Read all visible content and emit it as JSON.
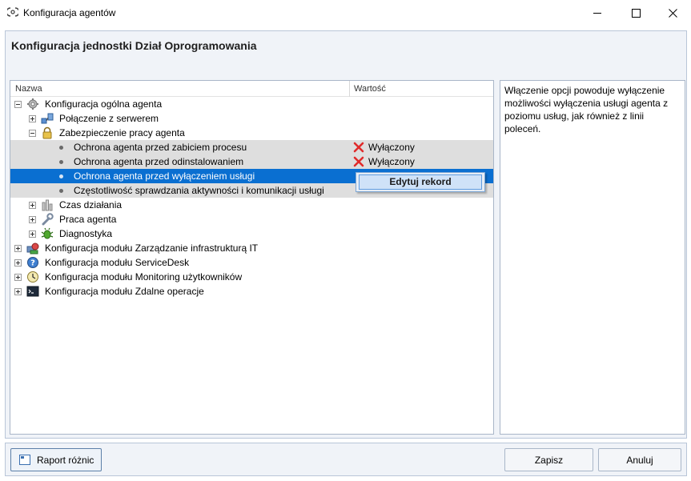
{
  "window": {
    "title": "Konfiguracja agentów",
    "minimize_icon": "minimize-icon",
    "maximize_icon": "maximize-icon",
    "close_icon": "close-icon"
  },
  "panel": {
    "title": "Konfiguracja jednostki Dział Oprogramowania"
  },
  "tree": {
    "columns": {
      "name": "Nazwa",
      "value": "Wartość"
    },
    "rows": [
      {
        "label": "Konfiguracja ogólna agenta",
        "icon": "gear-icon",
        "expanded": true
      },
      {
        "label": "Połączenie z serwerem",
        "icon": "network-icon",
        "expanded": false
      },
      {
        "label": "Zabezpieczenie pracy agenta",
        "icon": "lock-icon",
        "expanded": true
      },
      {
        "label": "Ochrona agenta przed zabiciem procesu",
        "value": "Wyłączony",
        "value_icon": "red-x-icon"
      },
      {
        "label": "Ochrona agenta przed odinstalowaniem",
        "value": "Wyłączony",
        "value_icon": "red-x-icon"
      },
      {
        "label": "Ochrona agenta przed wyłączeniem usługi",
        "selected": true
      },
      {
        "label": "Częstotliwość sprawdzania aktywności i komunikacji usługi"
      },
      {
        "label": "Czas działania",
        "icon": "hourglass-icon",
        "expanded": false
      },
      {
        "label": "Praca agenta",
        "icon": "wrench-icon",
        "expanded": false
      },
      {
        "label": "Diagnostyka",
        "icon": "bug-icon",
        "expanded": false
      },
      {
        "label": "Konfiguracja modułu Zarządzanie infrastrukturą IT",
        "icon": "infrastructure-icon",
        "expanded": false
      },
      {
        "label": "Konfiguracja modułu ServiceDesk",
        "icon": "servicedesk-icon",
        "expanded": false
      },
      {
        "label": "Konfiguracja modułu Monitoring użytkowników",
        "icon": "clock-icon",
        "expanded": false
      },
      {
        "label": "Konfiguracja modułu Zdalne operacje",
        "icon": "terminal-icon",
        "expanded": false
      }
    ]
  },
  "context_menu": {
    "edit_label": "Edytuj rekord"
  },
  "description": {
    "text": "Włączenie opcji powoduje wyłączenie możliwości wyłączenia usługi agenta z poziomu usług, jak również z linii poleceń."
  },
  "footer": {
    "report_label": "Raport różnic",
    "save_label": "Zapisz",
    "cancel_label": "Anuluj"
  },
  "colors": {
    "selection": "#0a6fd1",
    "disabled_value": "#e02a2a",
    "panel_bg": "#f0f3f8"
  }
}
